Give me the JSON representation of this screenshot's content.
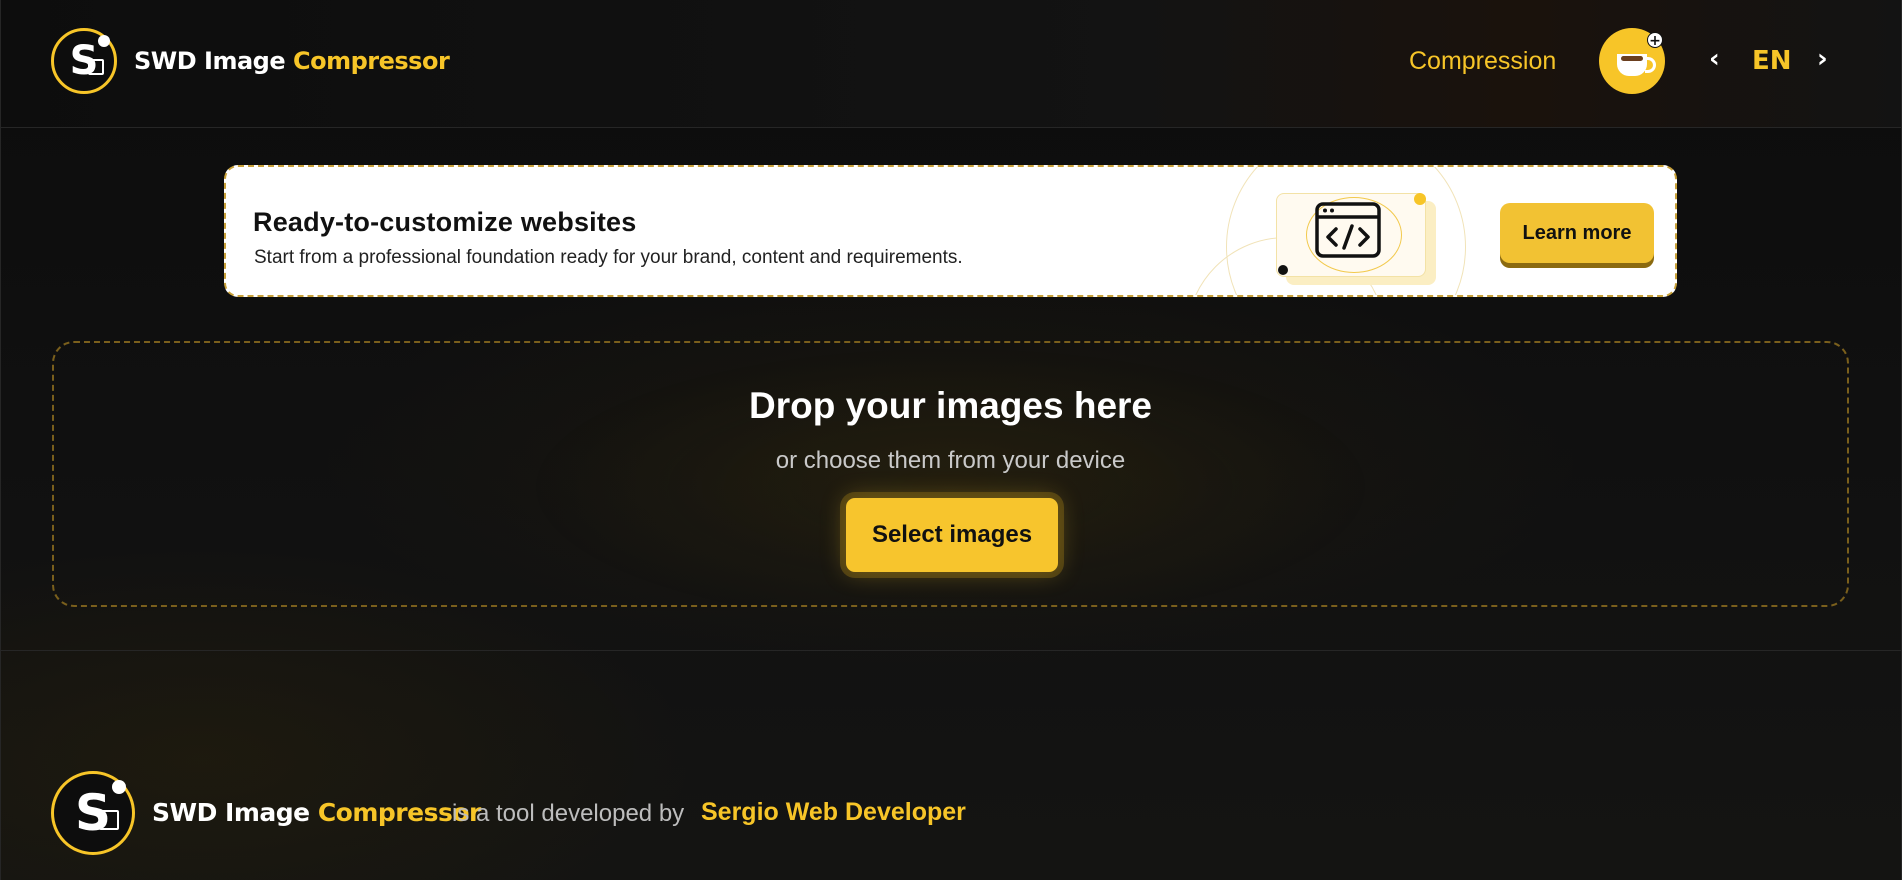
{
  "header": {
    "brand": {
      "part1": "SWD Image",
      "part2": "Compressor",
      "logo_letter": "S"
    },
    "nav": {
      "compression_label": "Compression"
    },
    "coffee": {
      "icon": "coffee-cup-icon",
      "plus": "+"
    },
    "language": {
      "prev": "‹",
      "code": "EN",
      "next": "›"
    }
  },
  "banner": {
    "title": "Ready-to-customize websites",
    "subtitle": "Start from a professional foundation ready for your brand, content and requirements.",
    "icon": "code-window-icon",
    "cta_label": "Learn more"
  },
  "dropzone": {
    "title": "Drop your images here",
    "subtitle": "or choose them from your device",
    "button_label": "Select images"
  },
  "footer": {
    "brand": {
      "part1": "SWD Image",
      "part2": "Compressor",
      "logo_letter": "S"
    },
    "text": "is a tool developed by",
    "link_label": "Sergio Web Developer"
  },
  "colors": {
    "accent": "#f7c528",
    "background": "#0e0e0e",
    "banner_bg": "#ffffff"
  }
}
